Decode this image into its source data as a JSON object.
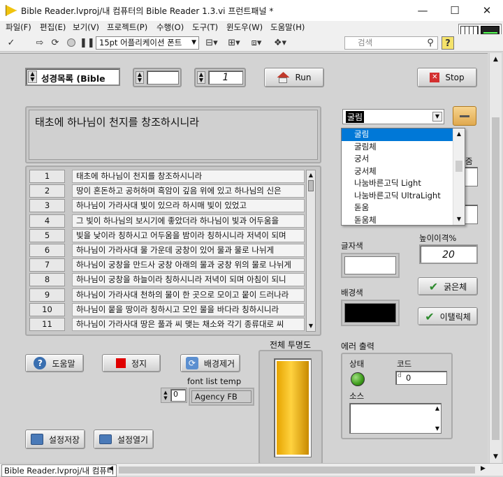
{
  "window": {
    "title": "Bible Reader.lvproj/내 컴퓨터의 Bible Reader 1.3.vi 프런트패널 *",
    "minimize": "—",
    "maximize": "☐",
    "close": "✕"
  },
  "menu": [
    "파일(F)",
    "편집(E)",
    "보기(V)",
    "프로젝트(P)",
    "수행(O)",
    "도구(T)",
    "윈도우(W)",
    "도움말(H)"
  ],
  "toolbar": {
    "font": "15pt 어플리케이션 폰트",
    "search_placeholder": "검색",
    "help": "?"
  },
  "controls": {
    "book": "성경목록 (Bible",
    "chapter": "",
    "verse": "1",
    "run": "Run",
    "stop": "Stop",
    "font_value": "굴림",
    "heading_text": "태초에 하나님이 천지를 창조하시니라"
  },
  "verses": [
    {
      "n": "1",
      "t": "태초에 하나님이 천지를 창조하시니라"
    },
    {
      "n": "2",
      "t": "땅이 혼돈하고 공허하며 흑암이 깊음 위에 있고 하나님의 신은"
    },
    {
      "n": "3",
      "t": "하나님이 가라사대 빛이 있으라 하시매 빛이 있었고"
    },
    {
      "n": "4",
      "t": "그 빛이 하나님의 보시기에 좋았더라 하나님이 빛과 어두움을"
    },
    {
      "n": "5",
      "t": "빛을 낮이라 칭하시고 어두움을 밤이라 칭하시니라 저녁이 되며"
    },
    {
      "n": "6",
      "t": "하나님이 가라사대 물 가운데 궁창이 있어 물과 물로 나뉘게"
    },
    {
      "n": "7",
      "t": "하나님이 궁창을 만드사 궁창 아래의 물과 궁창 위의 물로 나뉘게"
    },
    {
      "n": "8",
      "t": "하나님이 궁창을 하늘이라 칭하시니라 저녁이 되며 아침이 되니"
    },
    {
      "n": "9",
      "t": "하나님이 가라사대 천하의 물이 한 곳으로 모이고 뭍이 드러나라"
    },
    {
      "n": "10",
      "t": "하나님이 뭍을 땅이라 칭하시고 모인 물을 바다라 칭하시니라"
    },
    {
      "n": "11",
      "t": "하나님이 가라사대 땅은 풀과 씨 맺는 채소와 각기 종류대로 씨"
    }
  ],
  "font_list": [
    "굴림",
    "굴림체",
    "궁서",
    "궁서체",
    "나눔바른고딕 Light",
    "나눔바른고딕 UltraLight",
    "돋움",
    "돋움체"
  ],
  "right_panel": {
    "size_label_partial": "줌",
    "line_spacing_label": "높이이격%",
    "line_spacing_value": "20",
    "text_color_label": "글자색",
    "bg_color_label": "배경색",
    "bold": "굵은체",
    "italic": "이탤릭체"
  },
  "colors": {
    "bg_color": "#000000",
    "text_color": "#ffffff",
    "meter_fill": "#f0b800",
    "status_led": "#3c9a1a"
  },
  "bottom": {
    "help": "도움말",
    "stop": "정지",
    "remove_bg": "배경제거",
    "font_temp_label": "font list temp",
    "font_temp_index": "0",
    "font_temp_value": "Agency FB",
    "opacity_label": "전체 투명도",
    "save": "설정저장",
    "open": "설정열기",
    "opacity_level": 1.0
  },
  "error": {
    "label": "에러 출력",
    "status": "상태",
    "code": "코드",
    "code_prefix": "d",
    "code_value": "0",
    "source": "소스"
  },
  "statusbar": "Bible Reader.lvproj/내 컴퓨터"
}
